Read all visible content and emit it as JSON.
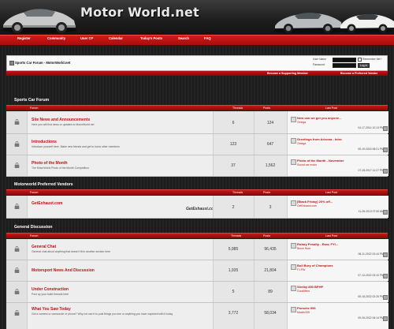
{
  "header": {
    "site_title": "Motor World.net"
  },
  "navbar": {
    "items": [
      "Register",
      "Community",
      "User CP",
      "Calendar",
      "Today's Posts",
      "Search",
      "FAQ"
    ]
  },
  "breadcrumb": {
    "text": "Sports Car Forum - MotorWorld.net"
  },
  "login": {
    "username_label": "User Name",
    "password_label": "Password",
    "remember_label": "Remember Me?",
    "login_button": "Log in"
  },
  "links_bar": {
    "supporting_member": "Become a Supporting Member",
    "preferred_vendor": "Become a Preferred Vendor"
  },
  "columns": {
    "forum": "Forum",
    "threads": "Threads",
    "posts": "Posts",
    "last_post": "Last Post"
  },
  "categories": [
    {
      "title": "Sports Car Forum",
      "forums": [
        {
          "title": "Site News and Announcements",
          "desc": "Here you will find news or updates to MotorWorld.net",
          "threads": "6",
          "posts": "124",
          "last_title": "New can we get you anyone...",
          "last_user": "Omega",
          "last_date": "04-17-2014 10:13 PM"
        },
        {
          "title": "Introductions",
          "desc": "Introduce yourself here. Make new friends and get to know other members",
          "threads": "123",
          "posts": "647",
          "last_title": "Greetings from Arizona - Intro",
          "last_user": "Omega",
          "last_date": "05-19-2015 08:21 PM"
        },
        {
          "title": "Photo of the Month",
          "desc": "The MotorWorld Photo of the Month Competition",
          "threads": "37",
          "posts": "1,562",
          "last_title": "Photo of the Month - November",
          "last_user": "Sound car motor",
          "last_date": "07-15-2017 11:27 PM"
        }
      ]
    },
    {
      "title": "Motorworld Preferred Vendors",
      "forums": [
        {
          "title": "GetExhaust.com",
          "desc": "",
          "threads": "2",
          "posts": "3",
          "banner": "GetExhaust.com",
          "last_title": "[Black Friday] 20% off...",
          "last_user": "GetExhaust.com",
          "last_date": "11-28-2013 07:50 AM"
        }
      ]
    },
    {
      "title": "General Discussion",
      "forums": [
        {
          "title": "General Chat",
          "desc": "General chat about anything that doesn't fit in another section here",
          "threads": "5,985",
          "posts": "96,435",
          "last_title": "Rotary Penalty - Eww, FYI...",
          "last_user": "Bruce Hunt",
          "last_date": "08-11-2022 02:44 PM"
        },
        {
          "title": "Motorsport News And Discussion",
          "desc": "",
          "threads": "1,935",
          "posts": "21,804",
          "last_title": "Bull Bury of Champions",
          "last_user": "F1 PW",
          "last_date": "07-14-2022 03:10 PM"
        },
        {
          "title": "Under Construction",
          "desc": "Post up your build threads here",
          "threads": "5",
          "posts": "89",
          "last_title": "Shelby 850 BPHP",
          "last_user": "Goodlifevs",
          "last_date": "05-18-2022 02:26 PM"
        },
        {
          "title": "What You Saw Today",
          "desc": "Got a camera or camcorder or phone? Why not use it to post things you see or anything you have captured with it today",
          "threads": "3,772",
          "posts": "58,034",
          "last_title": "Porsche 996",
          "last_user": "Marvin335",
          "last_date": "09-26-2022 06:14 PM"
        }
      ]
    }
  ],
  "colors": {
    "accent_red": "#c01010",
    "bar_red": "#a50e0e"
  }
}
